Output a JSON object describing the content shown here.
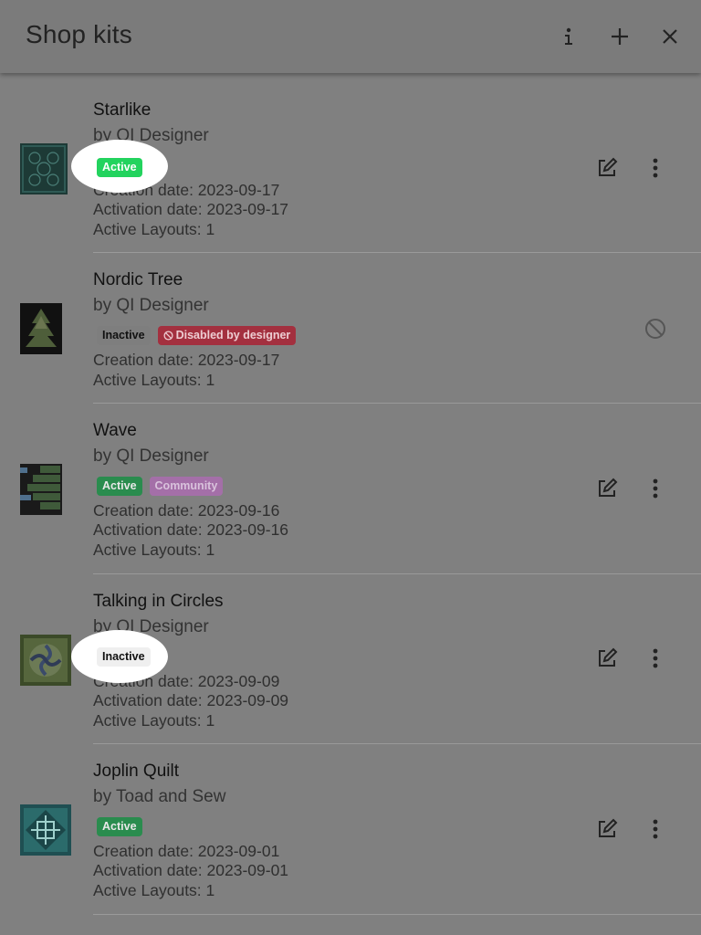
{
  "header": {
    "title": "Shop kits",
    "info_icon": "info-icon",
    "add_icon": "plus-icon",
    "close_icon": "close-icon"
  },
  "kits": [
    {
      "name": "Starlike",
      "by": "by QI Designer",
      "badges": [
        "Active"
      ],
      "creation": "Creation date: 2023-09-17",
      "activation": "Activation date: 2023-09-17",
      "layouts": "Active Layouts: 1"
    },
    {
      "name": "Nordic Tree",
      "by": "by QI Designer",
      "badges": [
        "Inactive",
        "Disabled by designer"
      ],
      "creation": "Creation date: 2023-09-17",
      "layouts": "Active Layouts: 1"
    },
    {
      "name": "Wave",
      "by": "by QI Designer",
      "badges": [
        "Active",
        "Community"
      ],
      "creation": "Creation date: 2023-09-16",
      "activation": "Activation date: 2023-09-16",
      "layouts": "Active Layouts: 1"
    },
    {
      "name": "Talking in Circles",
      "by": "by QI Designer",
      "badges": [
        "Inactive"
      ],
      "creation": "Creation date: 2023-09-09",
      "activation": "Activation date: 2023-09-09",
      "layouts": "Active Layouts: 1"
    },
    {
      "name": "Joplin Quilt",
      "by": "by Toad and Sew",
      "badges": [
        "Active"
      ],
      "creation": "Creation date: 2023-09-01",
      "activation": "Activation date: 2023-09-01",
      "layouts": "Active Layouts: 1"
    }
  ],
  "colors": {
    "overlay": "#808080",
    "active": "#2a8c4e",
    "active_highlight": "#23d35e",
    "disabled": "#a3303f",
    "community": "#a46fa8"
  }
}
